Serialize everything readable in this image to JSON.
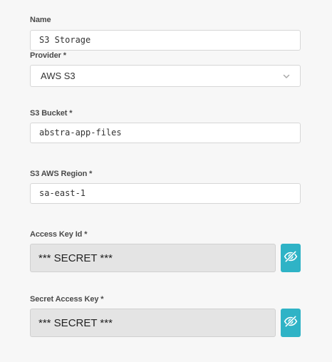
{
  "form": {
    "name": {
      "label": "Name",
      "value": "S3 Storage"
    },
    "provider": {
      "label": "Provider *",
      "value": "AWS S3"
    },
    "bucket": {
      "label": "S3 Bucket *",
      "value": "abstra-app-files"
    },
    "region": {
      "label": "S3 AWS Region *",
      "value": "sa-east-1"
    },
    "access_key": {
      "label": "Access Key Id *",
      "value": "*** SECRET ***"
    },
    "secret_key": {
      "label": "Secret Access Key *",
      "value": "*** SECRET ***"
    }
  },
  "icons": {
    "provider_dropdown": "chevron-down-icon",
    "toggle_visibility": "eye-off-icon"
  },
  "colors": {
    "accent": "#2fb3c6",
    "secret_bg": "#e4e4e4"
  }
}
